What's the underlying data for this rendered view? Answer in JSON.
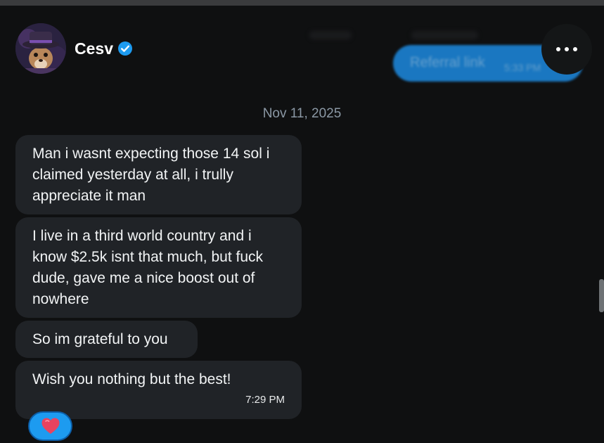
{
  "contact": {
    "name": "Cesv"
  },
  "sent_message": {
    "text": "Referral link",
    "time": "5:33 PM"
  },
  "date_divider": "Nov 11, 2025",
  "messages": [
    {
      "text": "Man i wasnt expecting those 14 sol i claimed yesterday at all, i trully appreciate it man"
    },
    {
      "text": "I live in a third world country and i know $2.5k isnt that much, but fuck dude, gave me a nice boost out of nowhere"
    },
    {
      "text": "So im grateful to you"
    },
    {
      "text": "Wish you nothing but the best!",
      "time": "7:29 PM"
    }
  ],
  "reaction": {
    "icon": "heart-icon",
    "color": "#e8435f"
  },
  "colors": {
    "background": "#0f1011",
    "received_bubble": "#202327",
    "sent_bubble": "#1d8ae0",
    "accent": "#1d9bf0"
  }
}
